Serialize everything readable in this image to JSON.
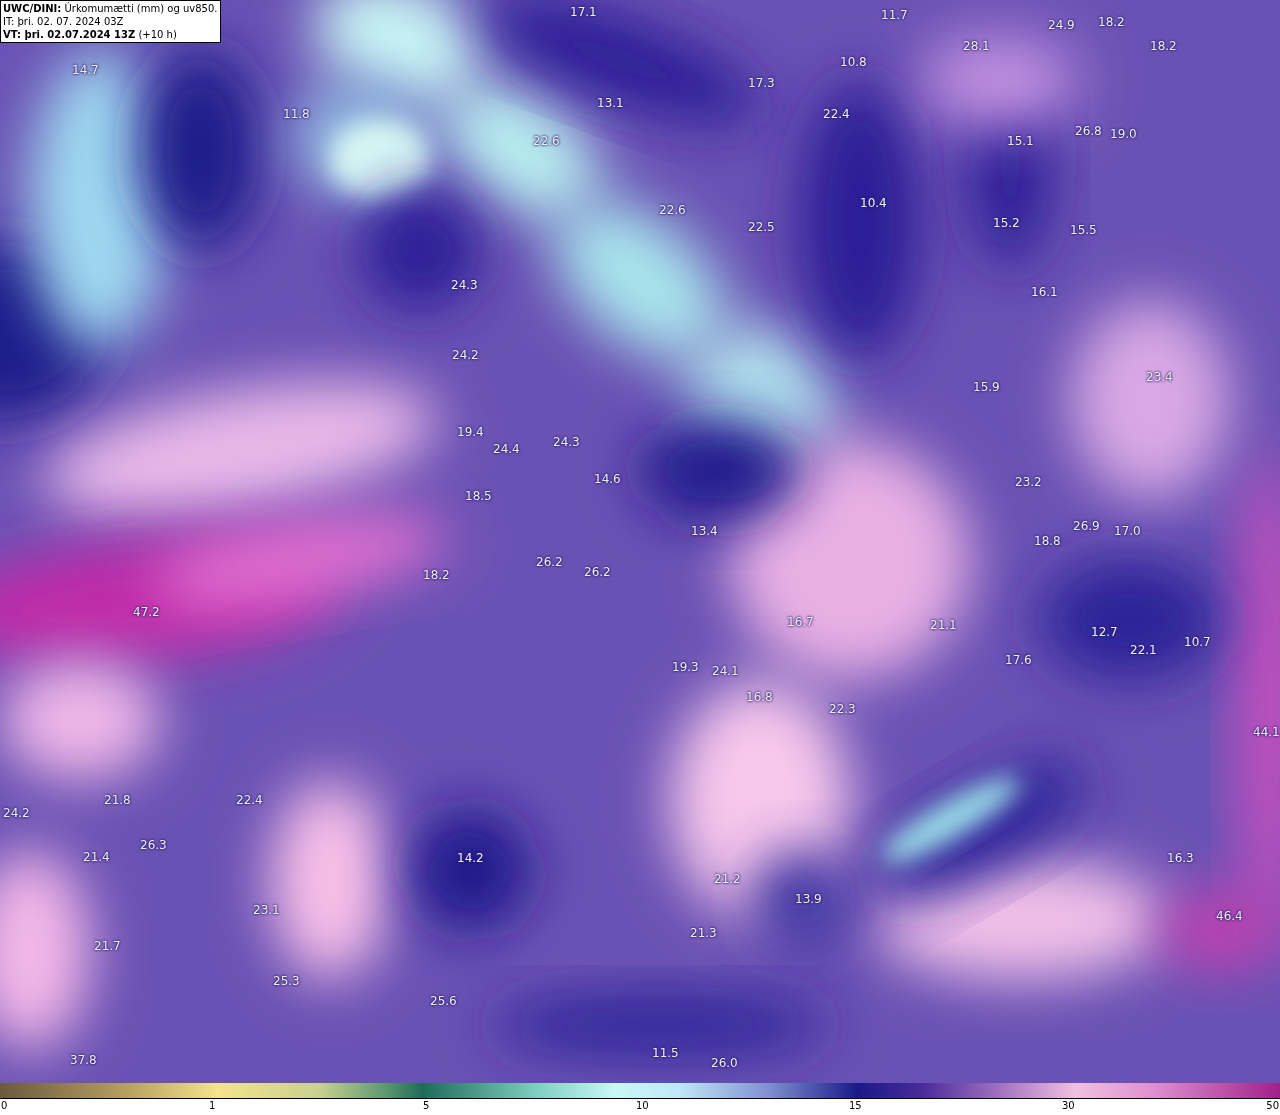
{
  "title_box": {
    "line_1": "**UWC/DINI:** Úrkomumætti (mm) og uv850.",
    "line_2": "IT: þri. 02. 07. 2024 03Z",
    "line_3": "**VT: þri. 02.07.2024 13Z** (+10 h)"
  },
  "map": {
    "value_labels": [
      "17.1",
      "11.7",
      "24.9",
      "18.2",
      "18.2",
      "14.7",
      "10.8",
      "28.1",
      "17.3",
      "13.1",
      "11.8",
      "22.4",
      "22.6",
      "15.1",
      "26.8",
      "19.0",
      "10.4",
      "22.6",
      "22.5",
      "15.2",
      "15.5",
      "24.3",
      "16.1",
      "24.2",
      "15.9",
      "23.4",
      "19.4",
      "24.4",
      "24.3",
      "14.6",
      "18.5",
      "13.4",
      "23.2",
      "26.9",
      "17.0",
      "18.8",
      "18.2",
      "26.2",
      "26.2",
      "47.2",
      "16.7",
      "21.1",
      "17.6",
      "12.7",
      "22.1",
      "10.7",
      "19.3",
      "24.1",
      "16.8",
      "22.3",
      "44.1",
      "21.8",
      "22.4",
      "24.2",
      "26.3",
      "21.4",
      "14.2",
      "16.3",
      "21.2",
      "13.9",
      "23.1",
      "46.4",
      "21.3",
      "21.7",
      "25.3",
      "25.6",
      "11.5",
      "26.0",
      "37.8"
    ]
  },
  "colorbar": {
    "ticks": [
      "0",
      "1",
      "5",
      "10",
      "15",
      "30",
      "50"
    ]
  }
}
